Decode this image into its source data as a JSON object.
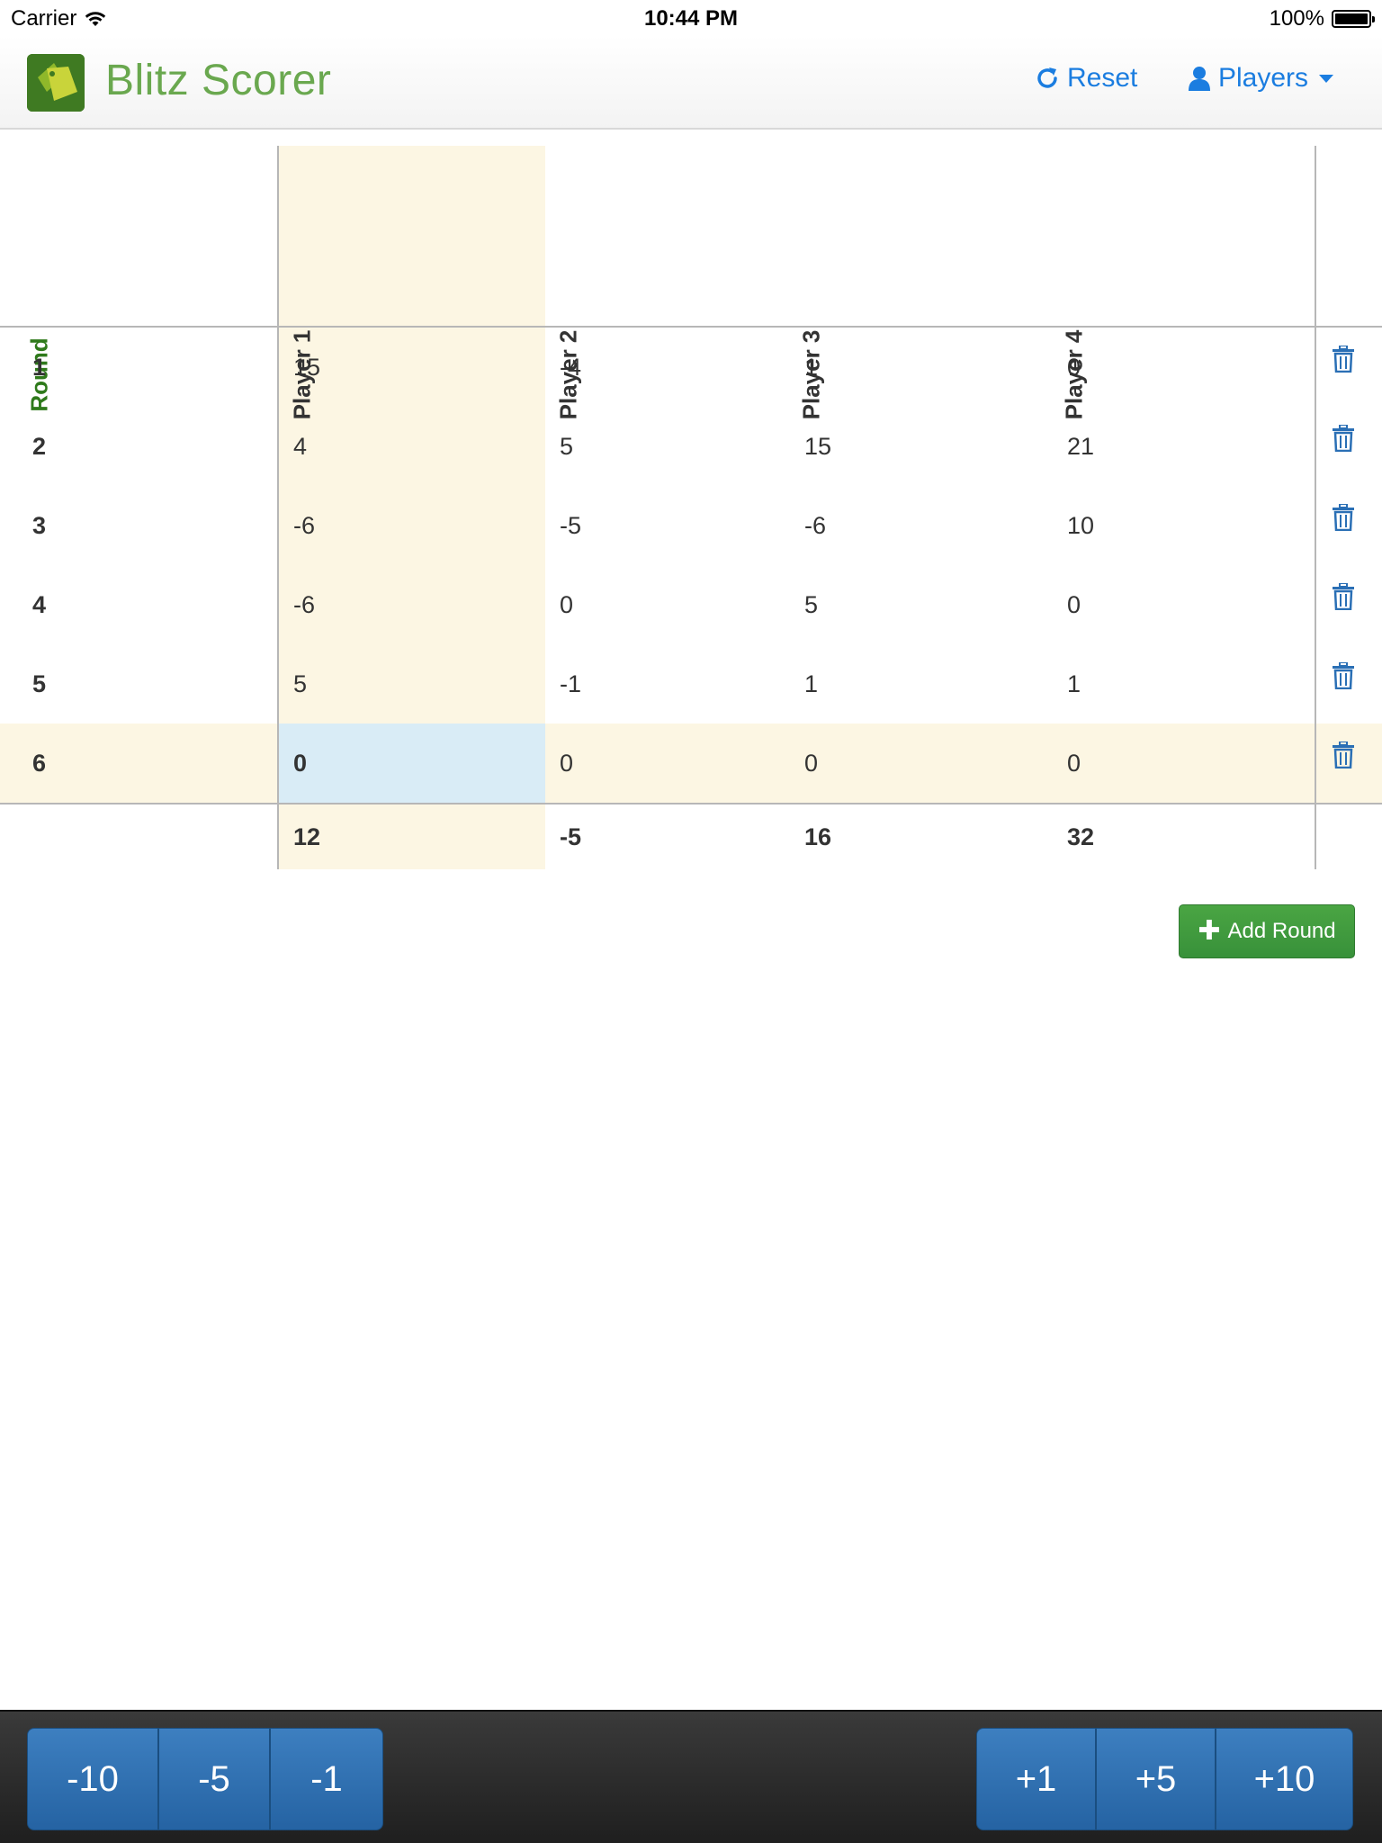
{
  "status_bar": {
    "carrier": "Carrier",
    "time": "10:44 PM",
    "battery": "100%"
  },
  "navbar": {
    "title": "Blitz Scorer",
    "reset_label": "Reset",
    "players_label": "Players"
  },
  "table": {
    "headers": {
      "round": "Round",
      "players": [
        "Player 1",
        "Player 2",
        "Player 3",
        "Player 4"
      ]
    },
    "rows": [
      {
        "round": "1",
        "scores": [
          "15",
          "-4",
          "1",
          "0"
        ]
      },
      {
        "round": "2",
        "scores": [
          "4",
          "5",
          "15",
          "21"
        ]
      },
      {
        "round": "3",
        "scores": [
          "-6",
          "-5",
          "-6",
          "10"
        ]
      },
      {
        "round": "4",
        "scores": [
          "-6",
          "0",
          "5",
          "0"
        ]
      },
      {
        "round": "5",
        "scores": [
          "5",
          "-1",
          "1",
          "1"
        ]
      },
      {
        "round": "6",
        "scores": [
          "0",
          "0",
          "0",
          "0"
        ]
      }
    ],
    "totals": [
      "12",
      "-5",
      "16",
      "32"
    ]
  },
  "add_round_label": "Add Round",
  "toolbar": {
    "decrement": [
      "-10",
      "-5",
      "-1"
    ],
    "increment": [
      "+1",
      "+5",
      "+10"
    ]
  },
  "colors": {
    "accent": "#1b7de0",
    "brand_green": "#6aa84f",
    "highlight": "#fcf6e3",
    "active_cell": "#d9ecf6",
    "button_blue": "#2f6fb0",
    "button_green": "#3f9c3f"
  }
}
